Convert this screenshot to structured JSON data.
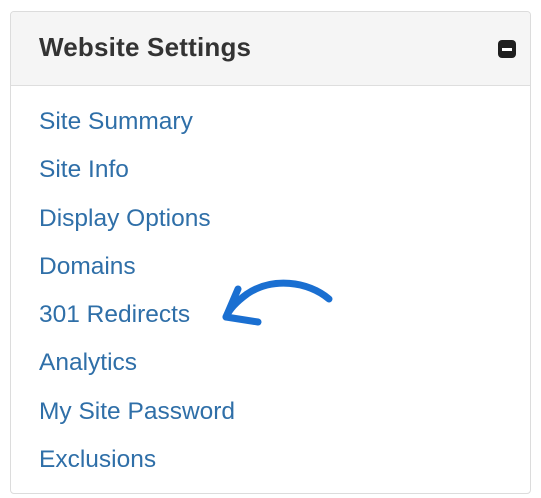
{
  "panel": {
    "title": "Website Settings",
    "collapse_icon": "minus-square-icon"
  },
  "menu": {
    "items": [
      {
        "label": "Site Summary"
      },
      {
        "label": "Site Info"
      },
      {
        "label": "Display Options"
      },
      {
        "label": "Domains"
      },
      {
        "label": "301 Redirects"
      },
      {
        "label": "Analytics"
      },
      {
        "label": "My Site Password"
      },
      {
        "label": "Exclusions"
      }
    ]
  },
  "annotation": {
    "icon": "curved-arrow-icon",
    "color": "#1a6fd1"
  },
  "colors": {
    "link": "#2f6fa8",
    "header_bg": "#f5f5f5",
    "title": "#333333"
  }
}
